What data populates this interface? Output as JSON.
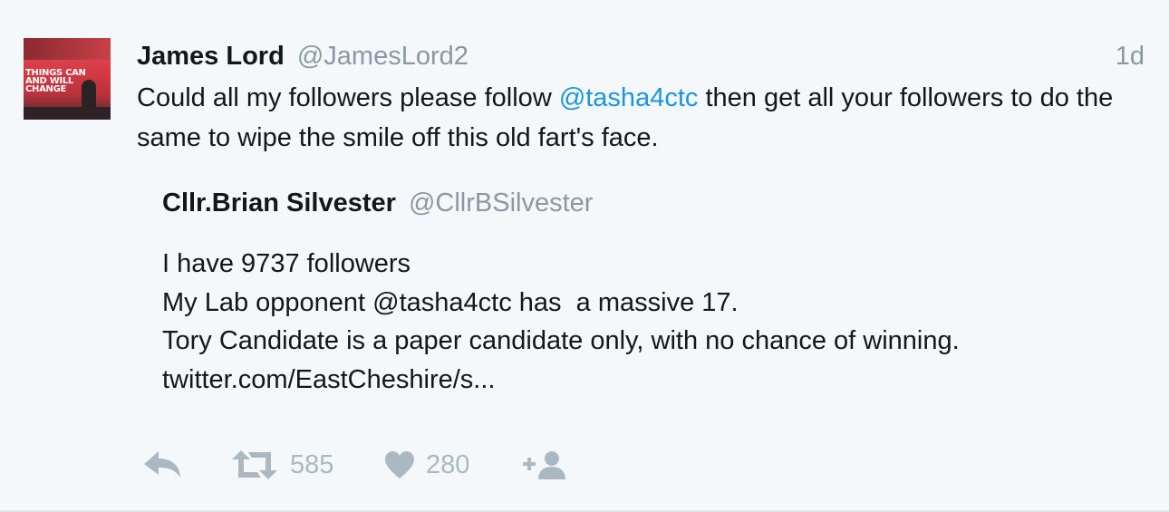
{
  "tweet": {
    "author_name": "James Lord",
    "author_handle": "@JamesLord2",
    "time": "1d",
    "text_before": "Could all my followers please follow ",
    "mention": "@tasha4ctc",
    "text_after": " then get all your followers to do the same to wipe the smile off this old fart's face.",
    "avatar_text": [
      "THINGS CAN",
      "AND WILL",
      "CHANGE"
    ]
  },
  "quoted_tweet": {
    "author_name": "Cllr.Brian Silvester",
    "author_handle": "@CllrBSilvester",
    "lines": [
      "I have 9737 followers",
      "My Lab opponent @tasha4ctc has  a massive 17.",
      "Tory Candidate is a paper candidate only, with no chance of winning.",
      "twitter.com/EastCheshire/s..."
    ]
  },
  "actions": {
    "reply_icon": "reply-icon",
    "retweet_icon": "retweet-icon",
    "retweet_count": "585",
    "like_icon": "heart-icon",
    "like_count": "280",
    "follow_icon": "follow-icon"
  },
  "colors": {
    "background": "#f5f8fa",
    "text": "#14171a",
    "muted": "#8899a6",
    "link": "#1b95e0",
    "action_icon": "#aab8c2"
  }
}
